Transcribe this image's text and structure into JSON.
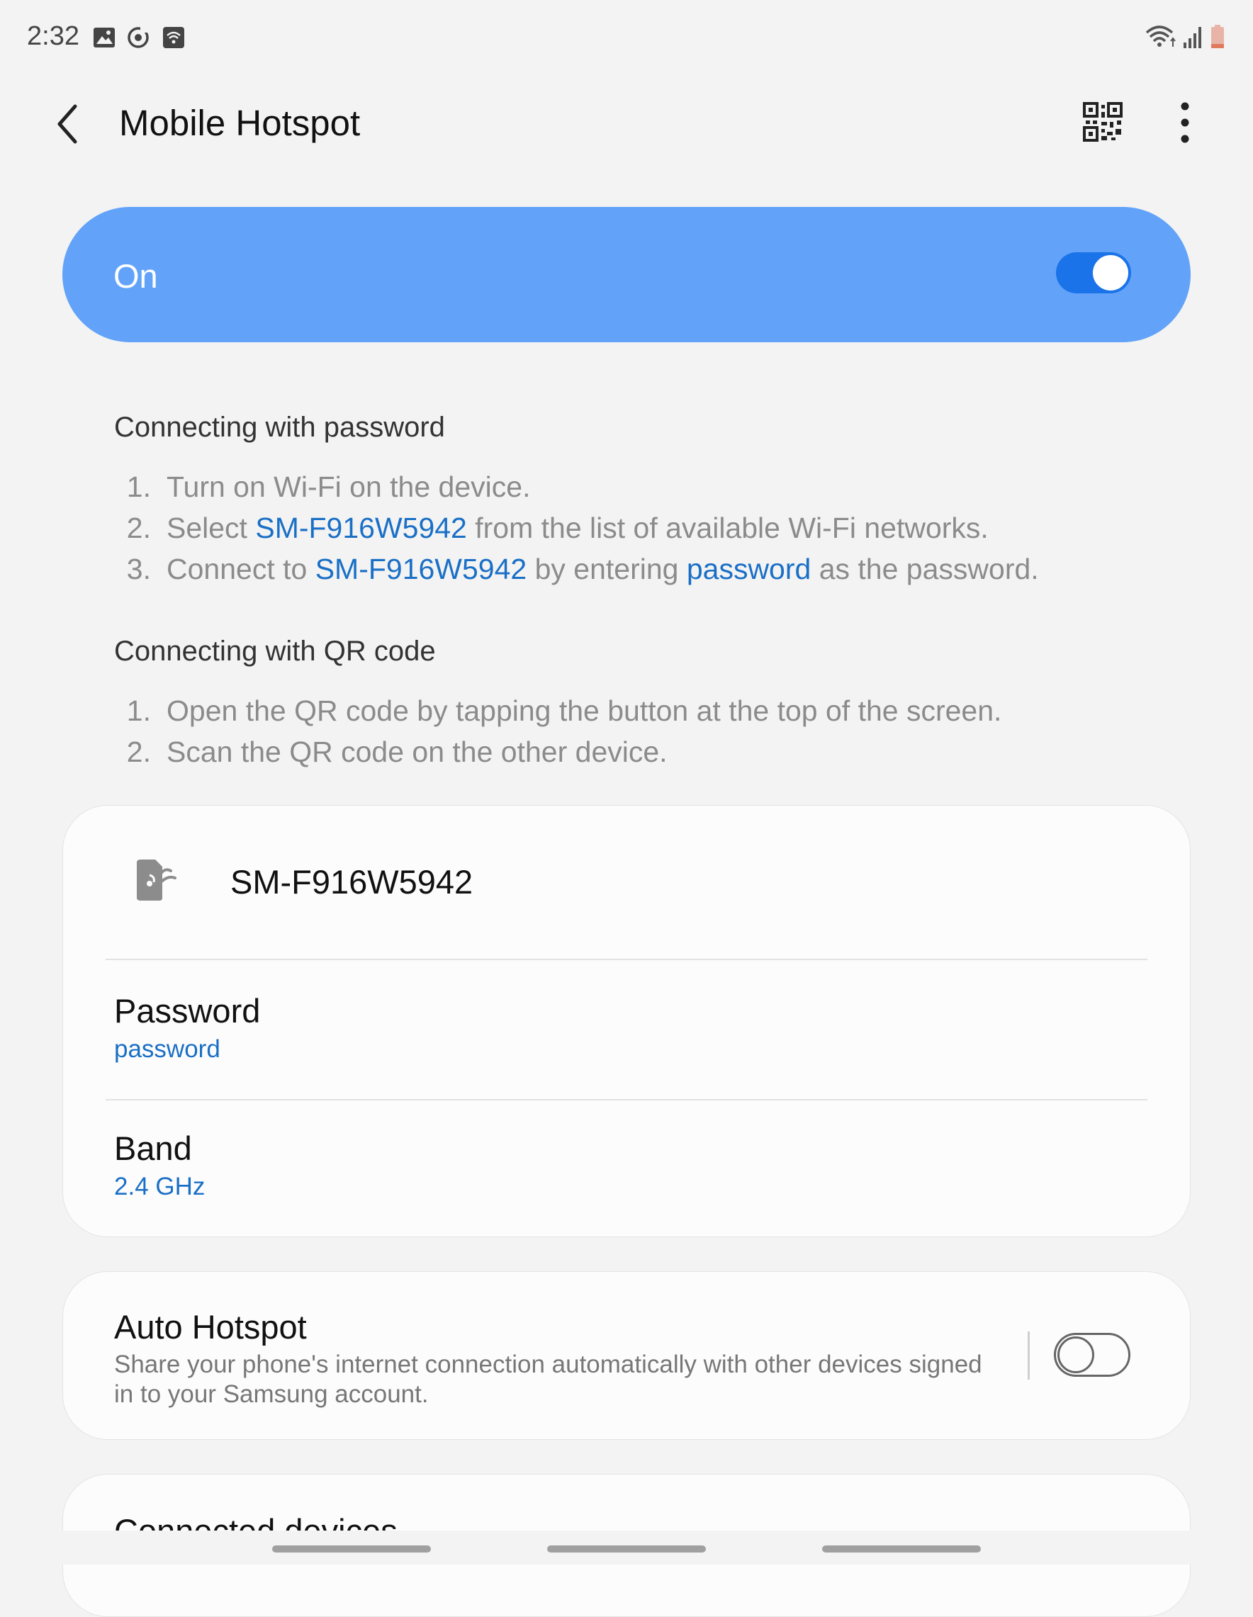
{
  "status_bar": {
    "time": "2:32",
    "left_icons": [
      "gallery-icon",
      "sync-icon",
      "hotspot-icon"
    ],
    "right_icons": [
      "wifi-icon",
      "signal-icon",
      "battery-icon"
    ]
  },
  "header": {
    "title": "Mobile Hotspot",
    "back_icon": "chevron-left-icon",
    "qr_icon": "qr-code-icon",
    "more_icon": "more-vert-icon"
  },
  "master_switch": {
    "label": "On",
    "state": true,
    "accent": "#62a3f9",
    "toggle_color": "#1a73e8"
  },
  "instructions": {
    "password": {
      "heading": "Connecting with password",
      "steps": [
        {
          "num": "1.",
          "parts": [
            "Turn on Wi-Fi on the device."
          ]
        },
        {
          "num": "2.",
          "parts": [
            "Select ",
            "SM-F916W5942",
            " from the list of available Wi-Fi networks."
          ]
        },
        {
          "num": "3.",
          "parts": [
            "Connect to ",
            "SM-F916W5942",
            " by entering ",
            "password",
            " as the password."
          ]
        }
      ]
    },
    "qr": {
      "heading": "Connecting with QR code",
      "steps": [
        {
          "num": "1.",
          "parts": [
            "Open the QR code by tapping the button at the top of the screen."
          ]
        },
        {
          "num": "2.",
          "parts": [
            "Scan the QR code on the other device."
          ]
        }
      ]
    }
  },
  "network_card": {
    "ssid": "SM-F916W5942",
    "ssid_icon": "hotspot-device-icon",
    "password_label": "Password",
    "password_value": "password",
    "band_label": "Band",
    "band_value": "2.4 GHz"
  },
  "auto_hotspot": {
    "title": "Auto Hotspot",
    "description_line1": "Share your phone's internet connection automatically with other devices signed",
    "description_line2": "in to your Samsung account.",
    "state": false
  },
  "connected_devices": {
    "title": "Connected devices"
  },
  "colors": {
    "link": "#1a6fc6",
    "background": "#f3f3f3"
  }
}
